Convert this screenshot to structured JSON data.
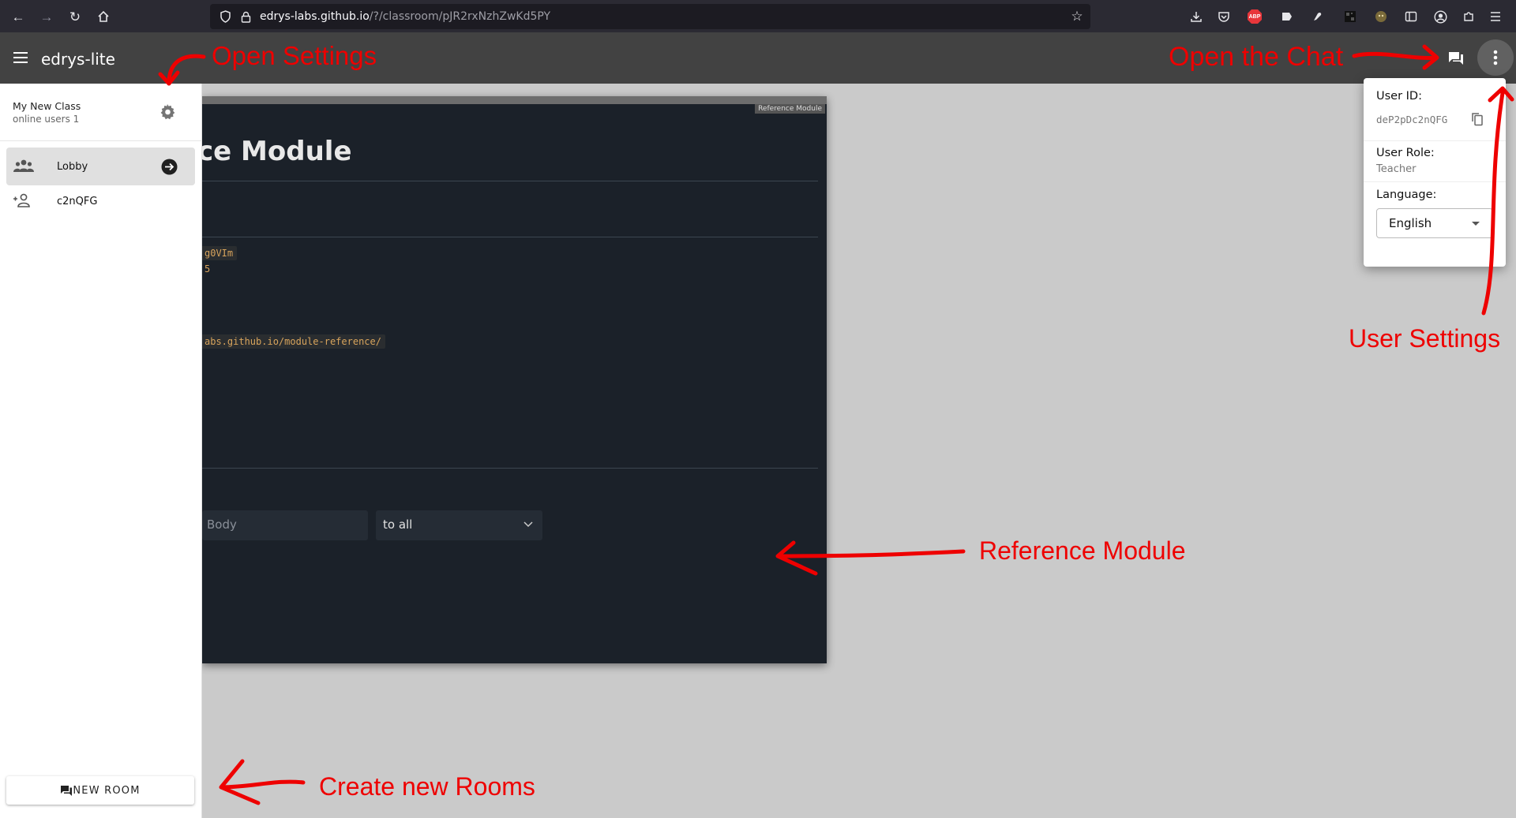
{
  "browser": {
    "url_host": "edrys-labs.github.io",
    "url_path": "/?/classroom/pJR2rxNzhZwKd5PY",
    "icons": [
      "back-icon",
      "forward-icon",
      "reload-icon",
      "home-icon",
      "shield-icon",
      "lock-icon",
      "star-icon",
      "download-icon",
      "pocket-icon",
      "adblock-icon",
      "extension-icon",
      "pin-icon",
      "qr-icon",
      "avatar-icon",
      "sidebar-icon",
      "account-icon",
      "puzzle-icon",
      "menu-icon"
    ],
    "adblock_label": "ABP"
  },
  "app": {
    "title": "edrys-lite",
    "accent": "#424242"
  },
  "sidebar": {
    "class_name": "My New Class",
    "online_users": "online users 1",
    "rooms": [
      {
        "label": "Lobby",
        "selected": true,
        "icon": "group-icon"
      },
      {
        "label": "c2nQFG",
        "selected": false,
        "icon": "person-add-icon"
      }
    ],
    "new_room_label": "NEW ROOM"
  },
  "module": {
    "tag": "Reference Module",
    "title": "ce Module",
    "code1": "g0VIm",
    "code2": "5",
    "code3": "abs.github.io/module-reference/",
    "body_placeholder": "Body",
    "target_select": "to all"
  },
  "user_menu": {
    "id_label": "User ID:",
    "id_value": "deP2pDc2nQFG",
    "role_label": "User Role:",
    "role_value": "Teacher",
    "language_label": "Language:",
    "language_value": "English"
  },
  "annotations": {
    "open_settings": "Open Settings",
    "open_chat": "Open the Chat",
    "user_settings": "User Settings",
    "reference_module": "Reference Module",
    "create_rooms": "Create new Rooms",
    "color": "#ee0000"
  }
}
